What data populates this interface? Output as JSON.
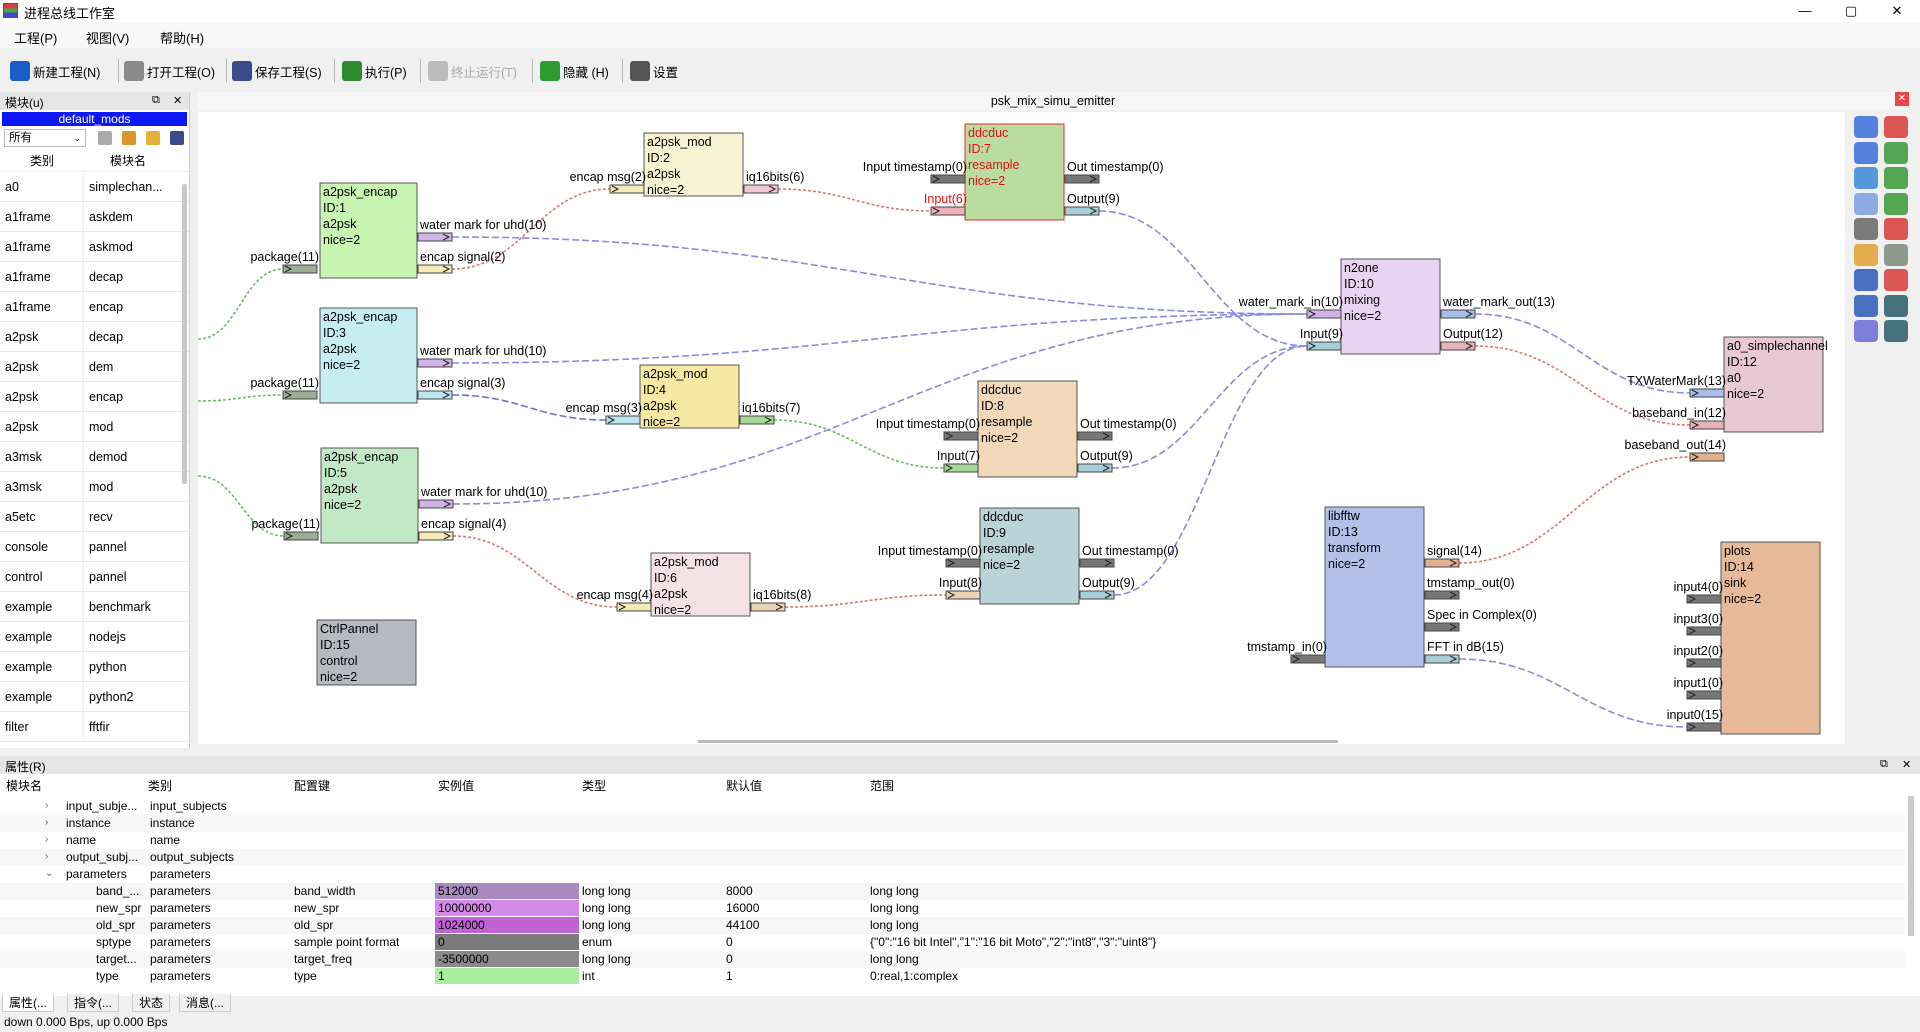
{
  "window": {
    "title": "进程总线工作室",
    "min": "—",
    "max": "▢",
    "close": "✕"
  },
  "menu": [
    "工程(P)",
    "视图(V)",
    "帮助(H)"
  ],
  "toolbar": [
    {
      "label": "新建工程(N)",
      "icon": "new-project-icon",
      "color": "#1a5fc8",
      "disabled": false
    },
    {
      "label": "打开工程(O)",
      "icon": "open-project-icon",
      "color": "#8a8a8a",
      "disabled": false
    },
    {
      "label": "保存工程(S)",
      "icon": "save-project-icon",
      "color": "#3b4a8a",
      "disabled": false
    },
    {
      "label": "执行(P)",
      "icon": "run-icon",
      "color": "#2e8b2e",
      "disabled": false
    },
    {
      "label": "终止运行(T)",
      "icon": "stop-icon",
      "color": "#bbbbbb",
      "disabled": true
    },
    {
      "label": "隐藏 (H)",
      "icon": "hide-tb-icon",
      "color": "#2e9b2e",
      "disabled": false
    },
    {
      "label": "设置",
      "icon": "settings-icon",
      "color": "#555555",
      "disabled": false
    }
  ],
  "left_panel": {
    "title": "模块(u)",
    "pin": "⧉",
    "close": "✕",
    "mods_title": "default_mods",
    "filter": "所有",
    "col_category": "类别",
    "col_name": "模块名",
    "rows": [
      [
        "a0",
        "simplechan..."
      ],
      [
        "a1frame",
        "askdem"
      ],
      [
        "a1frame",
        "askmod"
      ],
      [
        "a1frame",
        "decap"
      ],
      [
        "a1frame",
        "encap"
      ],
      [
        "a2psk",
        "decap"
      ],
      [
        "a2psk",
        "dem"
      ],
      [
        "a2psk",
        "encap"
      ],
      [
        "a2psk",
        "mod"
      ],
      [
        "a3msk",
        "demod"
      ],
      [
        "a3msk",
        "mod"
      ],
      [
        "a5etc",
        "recv"
      ],
      [
        "console",
        "pannel"
      ],
      [
        "control",
        "pannel"
      ],
      [
        "example",
        "benchmark"
      ],
      [
        "example",
        "nodejs"
      ],
      [
        "example",
        "python"
      ],
      [
        "example",
        "python2"
      ],
      [
        "filter",
        "fftfir"
      ]
    ]
  },
  "canvas": {
    "tab_title": "psk_mix_simu_emitter",
    "nodes": [
      {
        "lines": [
          "a2psk_encap",
          "ID:1",
          "a2psk",
          "nice=2"
        ],
        "color": "#c8f5b2",
        "text": "#000"
      },
      {
        "lines": [
          "a2psk_encap",
          "ID:3",
          "a2psk",
          "nice=2"
        ],
        "color": "#c6eef2",
        "text": "#000"
      },
      {
        "lines": [
          "a2psk_encap",
          "ID:5",
          "a2psk",
          "nice=2"
        ],
        "color": "#c3e8c6",
        "text": "#000"
      },
      {
        "lines": [
          "a2psk_mod",
          "ID:2",
          "a2psk",
          "nice=2"
        ],
        "color": "#f8f1d2",
        "text": "#000"
      },
      {
        "lines": [
          "a2psk_mod",
          "ID:4",
          "a2psk",
          "nice=2"
        ],
        "color": "#f7e9a4",
        "text": "#000"
      },
      {
        "lines": [
          "a2psk_mod",
          "ID:6",
          "a2psk",
          "nice=2"
        ],
        "color": "#f3e2e6",
        "text": "#000"
      },
      {
        "lines": [
          "ddcduc",
          "ID:7",
          "resample",
          "nice=2"
        ],
        "color": "#b9dca0",
        "text": "#e01010"
      },
      {
        "lines": [
          "ddcduc",
          "ID:8",
          "resample",
          "nice=2"
        ],
        "color": "#f1d8b8",
        "text": "#000"
      },
      {
        "lines": [
          "ddcduc",
          "ID:9",
          "resample",
          "nice=2"
        ],
        "color": "#bad3d8",
        "text": "#000"
      },
      {
        "lines": [
          "n2one",
          "ID:10",
          "mixing",
          "nice=2"
        ],
        "color": "#e8d3f3",
        "text": "#000"
      },
      {
        "lines": [
          "a0_simplechannel",
          "ID:12",
          "a0",
          "nice=2"
        ],
        "color": "#e8c8d2",
        "text": "#000"
      },
      {
        "lines": [
          "libfftw",
          "ID:13",
          "transform",
          "nice=2"
        ],
        "color": "#b3c0e8",
        "text": "#000"
      },
      {
        "lines": [
          "plots",
          "ID:14",
          "sink",
          "nice=2"
        ],
        "color": "#e6b99a",
        "text": "#000"
      },
      {
        "lines": [
          "CtrlPannel",
          "ID:15",
          "control",
          "nice=2"
        ],
        "color": "#b4bac0",
        "text": "#000"
      }
    ],
    "pins": [
      "package(11)",
      "water mark for uhd(10)",
      "encap signal(2)",
      "package(11)",
      "water mark for uhd(10)",
      "encap signal(3)",
      "package(11)",
      "water mark for uhd(10)",
      "encap signal(4)",
      "encap msg(2)",
      "iq16bits(6)",
      "encap msg(3)",
      "iq16bits(7)",
      "encap msg(4)",
      "iq16bits(8)",
      "Input timestamp(0)",
      "Input(6)",
      "Out timestamp(0)",
      "Output(9)",
      "Input timestamp(0)",
      "Input(7)",
      "Out timestamp(0)",
      "Output(9)",
      "Input timestamp(0)",
      "Input(8)",
      "Out timestamp(0)",
      "Output(9)",
      "water_mark_in(10)",
      "Input(9)",
      "water_mark_out(13)",
      "Output(12)",
      "TXWaterMark(13)",
      "baseband_in(12)",
      "baseband_out(14)",
      "tmstamp_in(0)",
      "signal(14)",
      "tmstamp_out(0)",
      "Spec in Complex(0)",
      "FFT in dB(15)",
      "input4(0)",
      "input3(0)",
      "input2(0)",
      "input1(0)",
      "input0(15)"
    ]
  },
  "bottom_panel": {
    "title": "属性(R)",
    "pin": "⧉",
    "close": "✕",
    "columns": [
      "模块名",
      "类别",
      "配置键",
      "实例值",
      "类型",
      "默认值",
      "范围"
    ],
    "rows": [
      {
        "twisty": "›",
        "name": "input_subje...",
        "cat": "input_subjects",
        "key": "",
        "val": "",
        "type": "",
        "def": "",
        "range": "",
        "valcolor": ""
      },
      {
        "twisty": "›",
        "name": "instance",
        "cat": "instance",
        "key": "",
        "val": "",
        "type": "",
        "def": "",
        "range": "",
        "valcolor": ""
      },
      {
        "twisty": "›",
        "name": "name",
        "cat": "name",
        "key": "",
        "val": "",
        "type": "",
        "def": "",
        "range": "",
        "valcolor": ""
      },
      {
        "twisty": "›",
        "name": "output_subj...",
        "cat": "output_subjects",
        "key": "",
        "val": "",
        "type": "",
        "def": "",
        "range": "",
        "valcolor": ""
      },
      {
        "twisty": "⌄",
        "name": "parameters",
        "cat": "parameters",
        "key": "",
        "val": "",
        "type": "",
        "def": "",
        "range": "",
        "valcolor": ""
      },
      {
        "twisty": "",
        "name": "band_...",
        "cat": "parameters",
        "key": "band_width",
        "val": "512000",
        "type": "long long",
        "def": "8000",
        "range": "long long",
        "valcolor": "#a98bc2"
      },
      {
        "twisty": "",
        "name": "new_spr",
        "cat": "parameters",
        "key": "new_spr",
        "val": "10000000",
        "type": "long long",
        "def": "16000",
        "range": "long long",
        "valcolor": "#d589e8"
      },
      {
        "twisty": "",
        "name": "old_spr",
        "cat": "parameters",
        "key": "old_spr",
        "val": "1024000",
        "type": "long long",
        "def": "44100",
        "range": "long long",
        "valcolor": "#bf62d2"
      },
      {
        "twisty": "",
        "name": "sptype",
        "cat": "parameters",
        "key": "sample point format",
        "val": "0",
        "type": "enum",
        "def": "0",
        "range": "{\"0\":\"16 bit Intel\",\"1\":\"16 bit Moto\",\"2\":\"int8\",\"3\":\"uint8\"}",
        "valcolor": "#7b7b7b"
      },
      {
        "twisty": "",
        "name": "target...",
        "cat": "parameters",
        "key": "target_freq",
        "val": "-3500000",
        "type": "long long",
        "def": "0",
        "range": "long long",
        "valcolor": "#8a8a8a"
      },
      {
        "twisty": "",
        "name": "type",
        "cat": "parameters",
        "key": "type",
        "val": "1",
        "type": "int",
        "def": "1",
        "range": "0:real,1:complex",
        "valcolor": "#a8f0a0"
      }
    ]
  },
  "bottom_tabs": [
    "属性(...",
    "指令(...",
    "状态",
    "消息(..."
  ],
  "status": "down 0.000 Bps, up 0.000 Bps"
}
